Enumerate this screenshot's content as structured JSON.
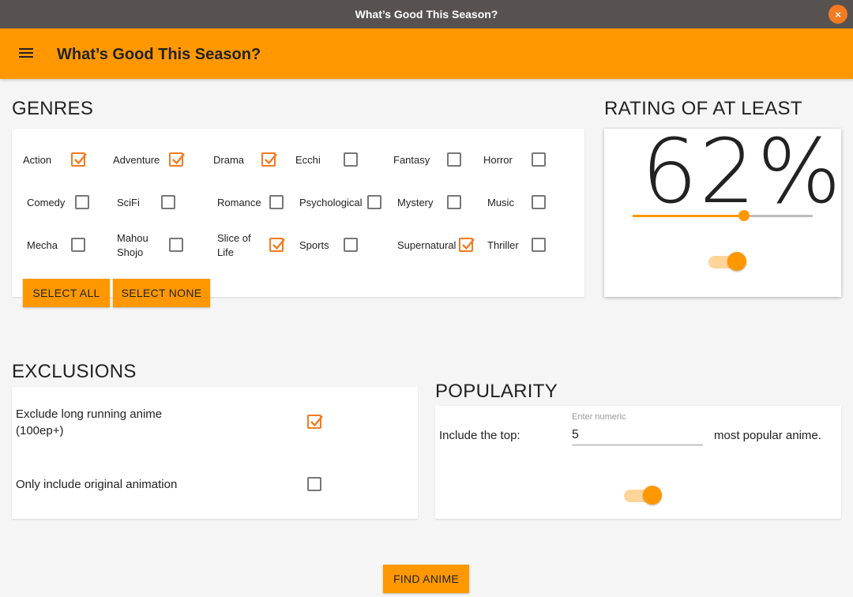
{
  "window": {
    "title": "What’s Good This Season?",
    "close_glyph": "×"
  },
  "appbar": {
    "title": "What’s Good This Season?"
  },
  "genres": {
    "heading": "GENRES",
    "items": [
      {
        "label": "Action",
        "checked": true
      },
      {
        "label": "Adventure",
        "checked": true
      },
      {
        "label": "Drama",
        "checked": true
      },
      {
        "label": "Ecchi",
        "checked": false
      },
      {
        "label": "Fantasy",
        "checked": false
      },
      {
        "label": "Horror",
        "checked": false
      },
      {
        "label": "Comedy",
        "checked": false
      },
      {
        "label": "SciFi",
        "checked": false
      },
      {
        "label": "Romance",
        "checked": false
      },
      {
        "label": "Psychological",
        "checked": false
      },
      {
        "label": "Mystery",
        "checked": false
      },
      {
        "label": "Music",
        "checked": false
      },
      {
        "label": "Mecha",
        "checked": false
      },
      {
        "label": "Mahou Shojo",
        "checked": false
      },
      {
        "label": "Slice of Life",
        "checked": true
      },
      {
        "label": "Sports",
        "checked": false
      },
      {
        "label": "Supernatural",
        "checked": true
      },
      {
        "label": "Thriller",
        "checked": false
      }
    ],
    "select_all_label": "SELECT ALL",
    "select_none_label": "SELECT NONE"
  },
  "rating": {
    "heading": "RATING OF AT LEAST",
    "value_text": "62%",
    "slider_value": 0.62,
    "toggle_on": true
  },
  "exclusions": {
    "heading": "EXCLUSIONS",
    "items": [
      {
        "label": "Exclude long running anime (100ep+)",
        "checked": true
      },
      {
        "label": "Only include original animation",
        "checked": false
      }
    ]
  },
  "popularity": {
    "heading": "POPULARITY",
    "prefix": "Include the top:",
    "helper": "Enter numeric",
    "value": "5",
    "suffix": "most popular anime.",
    "toggle_on": true
  },
  "find_label": "FIND ANIME",
  "colors": {
    "accent": "#ff9800",
    "checkmark": "#f47b20",
    "titlebar": "#575250"
  }
}
